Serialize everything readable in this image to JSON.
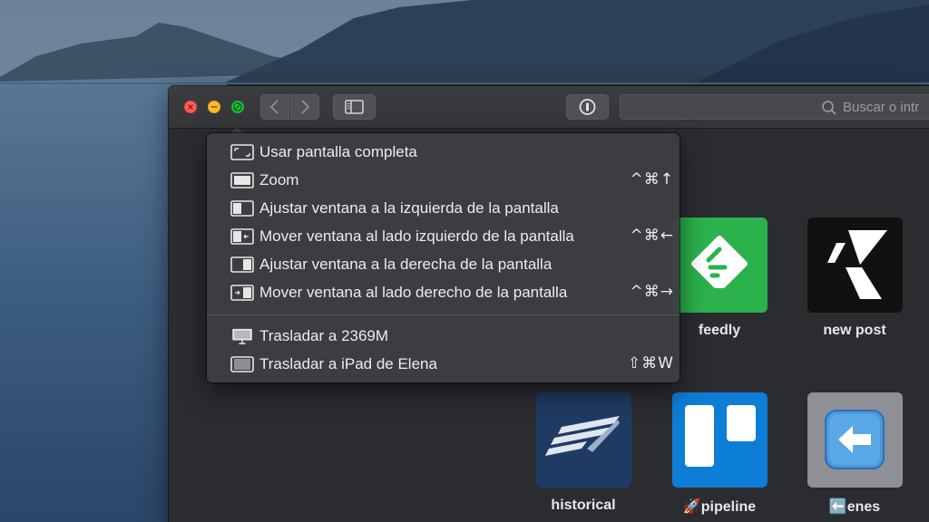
{
  "search": {
    "placeholder": "Buscar o intr"
  },
  "menu": {
    "items": [
      {
        "label": "Usar pantalla completa",
        "shortcut": "",
        "icon": "fullscreen-icon"
      },
      {
        "label": "Zoom",
        "shortcut": "^⌘↑",
        "icon": "zoom-window-icon"
      },
      {
        "label": "Ajustar ventana a la izquierda de la pantalla",
        "shortcut": "",
        "icon": "tile-left-icon"
      },
      {
        "label": "Mover ventana al lado izquierdo de la pantalla",
        "shortcut": "^⌘←",
        "icon": "move-left-icon"
      },
      {
        "label": "Ajustar ventana a la derecha de la pantalla",
        "shortcut": "",
        "icon": "tile-right-icon"
      },
      {
        "label": "Mover ventana al lado derecho de la pantalla",
        "shortcut": "^⌘→",
        "icon": "move-right-icon"
      }
    ],
    "items2": [
      {
        "label": "Trasladar a 2369M",
        "shortcut": "",
        "icon": "display-icon"
      },
      {
        "label": "Trasladar a iPad de Elena",
        "shortcut": "⇧⌘W",
        "icon": "ipad-icon"
      }
    ]
  },
  "favorites": [
    {
      "label": "feedly",
      "icon": "feedly-icon",
      "color": "#2bb24c"
    },
    {
      "label": "new post",
      "icon": "newpost-icon",
      "color": "#111111"
    },
    {
      "label": "historical",
      "icon": "historical-icon",
      "color": "#1f3b63"
    },
    {
      "label": "🚀pipeline",
      "icon": "trello-icon",
      "color": "#0c7ed6"
    },
    {
      "label": "⬅️enes",
      "icon": "back-arrow-emoji-icon",
      "color": "#8f9096"
    }
  ],
  "colors": {
    "close": "#ff5f57",
    "minimize": "#febc2e",
    "zoom": "#28c840",
    "menu_bg": "#3e3e42",
    "window_bg": "#2b2c30"
  }
}
